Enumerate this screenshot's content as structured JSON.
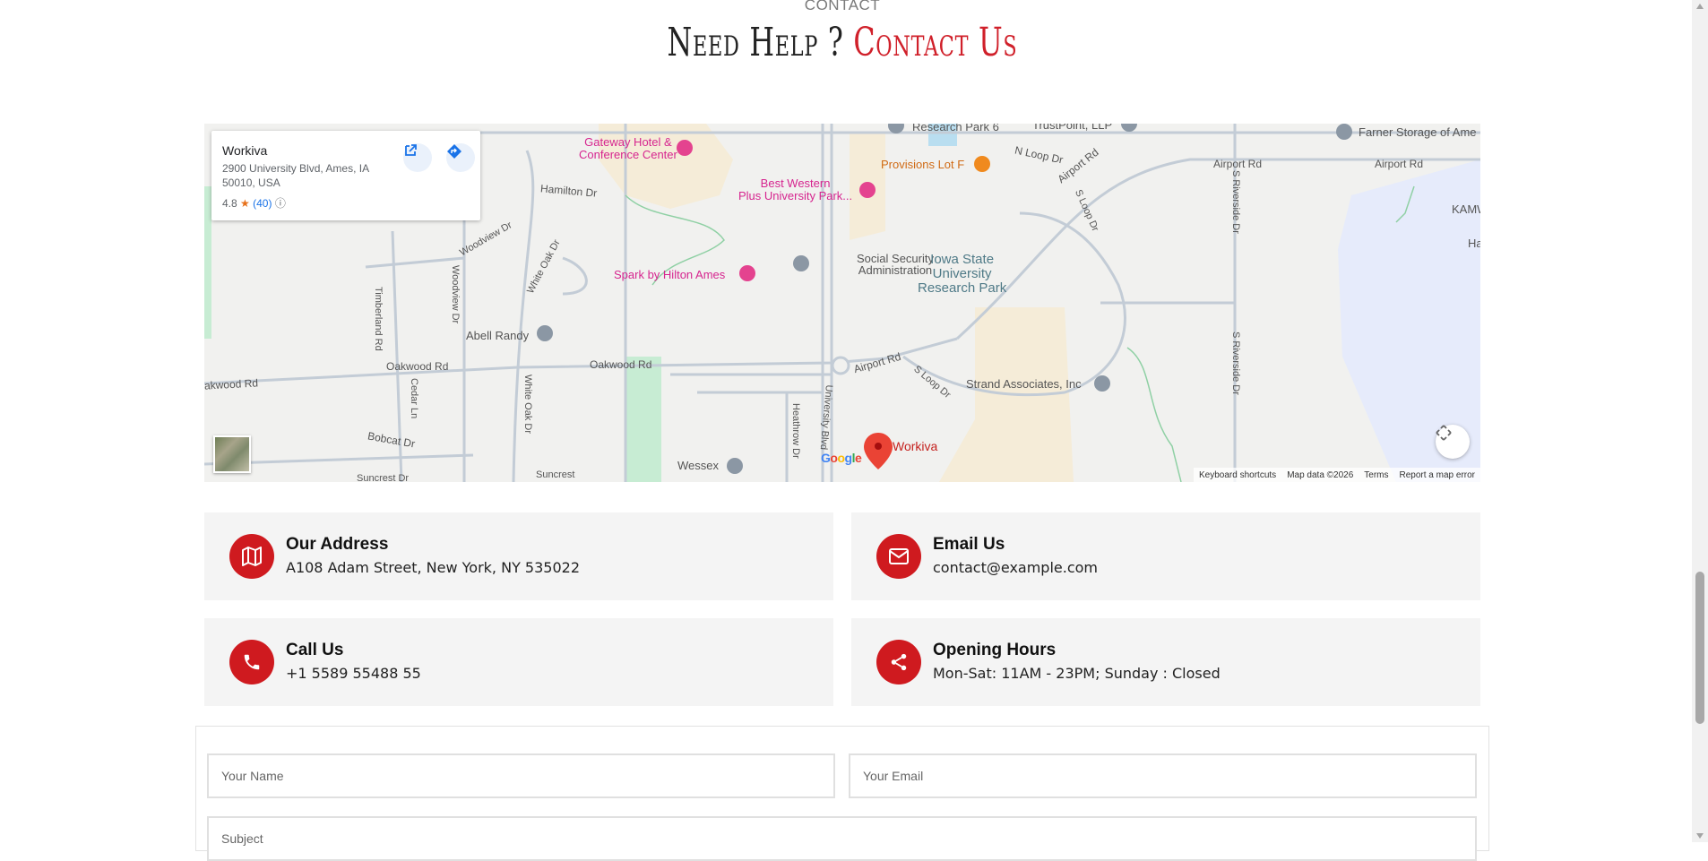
{
  "section": {
    "eyebrow": "CONTACT",
    "title_main": "Need Help ? ",
    "title_accent": "Contact Us",
    "accent_color": "#d0202a"
  },
  "map": {
    "place": {
      "name": "Workiva",
      "address": "2900 University Blvd, Ames, IA 50010, USA",
      "rating": "4.8",
      "review_count": "(40)"
    },
    "labels": {
      "gateway_hotel": "Gateway Hotel &",
      "gateway_hotel2": "Conference Center",
      "best_western": "Best Western",
      "best_western2": "Plus University Park...",
      "provisions": "Provisions Lot F",
      "research_park_6": "Research Park 6",
      "trustpoint": "TrustPoint, LLP",
      "farner": "Farner Storage of Ame",
      "kamw": "KAMW",
      "ha": "Ha",
      "hamilton": "Hamilton Dr",
      "woodview_dr": "Woodview Dr",
      "woodview_dr2": "Woodview Dr",
      "white_oak_dr": "White Oak Dr",
      "white_oak_dr2": "White Oak Dr",
      "social_security": "Social Security",
      "social_security2": "Administration",
      "isu_1": "Iowa State",
      "isu_2": "University",
      "isu_3": "Research Park",
      "spark": "Spark by Hilton Ames",
      "timberland": "Timberland Rd",
      "abell": "Abell Randy",
      "oakwood_1": "akwood Rd",
      "oakwood_2": "Oakwood Rd",
      "oakwood_3": "Oakwood Rd",
      "cedar": "Cedar Ln",
      "airport_1": "Airport Rd",
      "airport_2": "Airport Rd",
      "airport_3": "Airport Rd",
      "airport_4": "Airport Rd",
      "n_loop": "N Loop Dr",
      "s_loop": "S Loop Dr",
      "s_loop2": "S Loop Dr",
      "s_riverside": "S Riverside Dr",
      "s_riverside2": "S Riverside Dr",
      "strand": "Strand Associates, Inc",
      "bobcat": "Bobcat Dr",
      "suncrest": "Suncrest Dr",
      "suncrest2": "Suncrest",
      "heathrow": "Heathrow Dr",
      "university_blvd": "University Blvd",
      "wessex": "Wessex",
      "workiva_marker": "Workiva"
    },
    "google_letters": [
      "G",
      "o",
      "o",
      "g",
      "l",
      "e"
    ],
    "footer": {
      "shortcuts": "Keyboard shortcuts",
      "data": "Map data ©2026",
      "terms": "Terms",
      "report": "Report a map error"
    }
  },
  "info_cards": [
    {
      "icon": "map-icon",
      "title": "Our Address",
      "text": "A108 Adam Street, New York, NY 535022"
    },
    {
      "icon": "envelope-icon",
      "title": "Email Us",
      "text": "contact@example.com"
    },
    {
      "icon": "phone-icon",
      "title": "Call Us",
      "text": "+1 5589 55488 55"
    },
    {
      "icon": "share-icon",
      "title": "Opening Hours",
      "text": "Mon-Sat: 11AM - 23PM; Sunday : Closed"
    }
  ],
  "form": {
    "name_placeholder": "Your Name",
    "email_placeholder": "Your Email",
    "subject_placeholder": "Subject"
  }
}
